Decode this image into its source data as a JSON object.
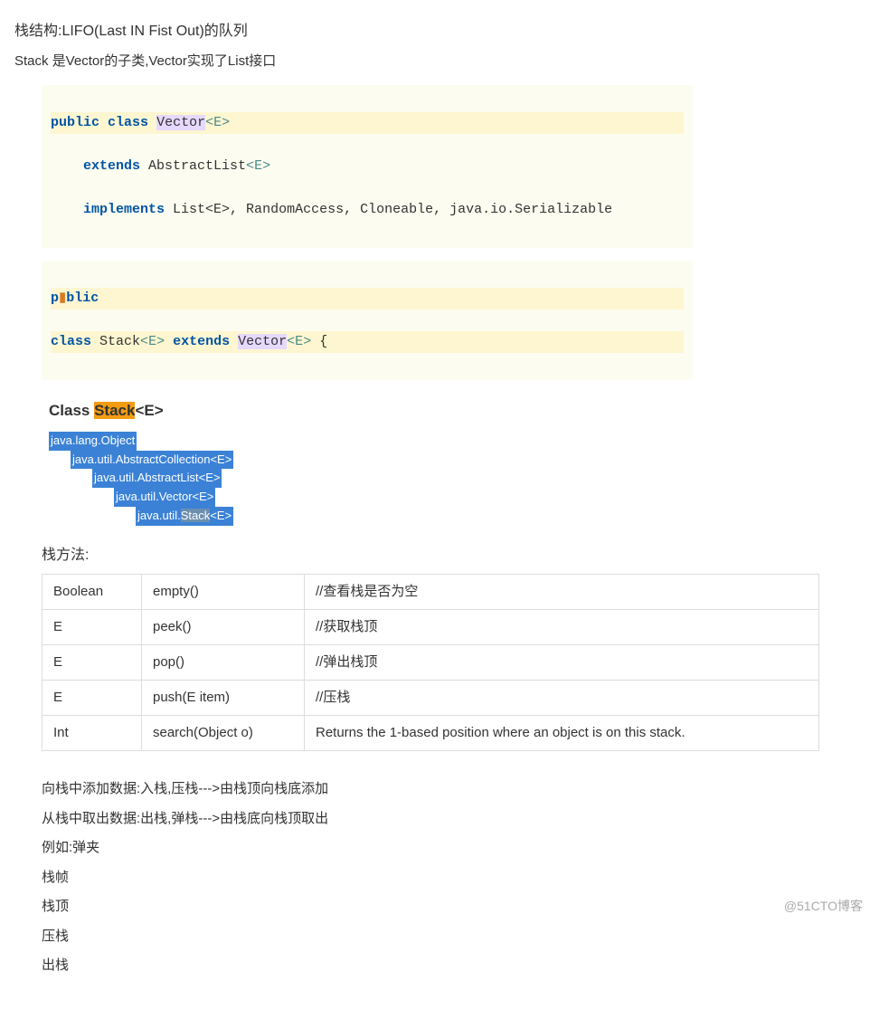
{
  "title": "栈结构:LIFO(Last IN Fist Out)的队列",
  "subtitle": "Stack 是Vector的子类,Vector实现了List接口",
  "code1": {
    "tokens": {
      "public": "public",
      "class": "class",
      "vector": "Vector",
      "e": "E",
      "extends": "extends",
      "abstractlist": "AbstractList",
      "implements": "implements",
      "rest": "List<E>, RandomAccess, Cloneable, java.io.Serializable"
    }
  },
  "code2": {
    "tokens": {
      "p": "p",
      "blic": "blic",
      "class": "class",
      "stack": "Stack",
      "e": "E",
      "extends": "extends",
      "vector": "Vector",
      "brace": " {"
    }
  },
  "class_heading": {
    "class": "Class ",
    "stack": "Stack",
    "e": "<E>"
  },
  "hierarchy": [
    "java.lang.Object",
    "java.util.AbstractCollection<E>",
    "java.util.AbstractList<E>",
    "java.util.Vector<E>",
    "java.util.Stack<E>"
  ],
  "hierarchy_last": {
    "pre": "java.util.",
    "stack": "Stack",
    "post": "<E>"
  },
  "methods_label": "栈方法:",
  "methods": [
    {
      "ret": "Boolean",
      "sig": "empty()",
      "desc": "//查看栈是否为空"
    },
    {
      "ret": "E",
      "sig": "peek()",
      "desc": "//获取栈顶"
    },
    {
      "ret": "E",
      "sig": "pop()",
      "desc": "//弹出栈顶"
    },
    {
      "ret": "E",
      "sig": "push(E item)",
      "desc": "//压栈"
    },
    {
      "ret": "Int",
      "sig": "search(Object o)",
      "desc": "Returns the 1-based position where an object is on this stack."
    }
  ],
  "notes": [
    "向栈中添加数据:入栈,压栈--->由栈顶向栈底添加",
    "从栈中取出数据:出栈,弹栈--->由栈底向栈顶取出",
    "例如:弹夹",
    "栈帧",
    "栈顶",
    "压栈",
    "出栈"
  ],
  "watermark": "@51CTO博客"
}
